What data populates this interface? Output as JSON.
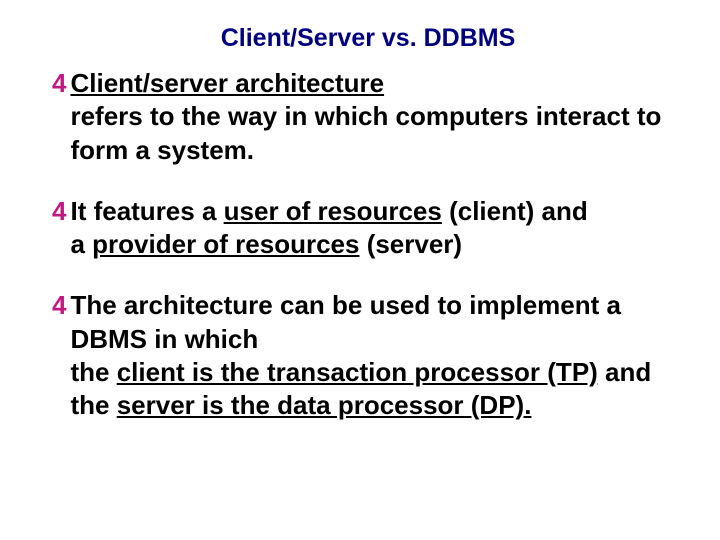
{
  "title": "Client/Server vs. DDBMS",
  "bullets": {
    "b0": {
      "lead": "Client/server architecture",
      "rest": "refers to the way in which computers interact to form a system."
    },
    "b1": {
      "pre": "It features a ",
      "u1": "user of resources",
      "mid1": " (client) and",
      "br": "a ",
      "u2": "provider of resources",
      "mid2": " (server)"
    },
    "b2": {
      "l1": "The architecture can be used to implement a DBMS in which",
      "l2a": "the ",
      "u1": "client is the transaction processor (TP)",
      "l2b": " and the ",
      "u2": "server is the data processor (DP).",
      "l2c": ""
    }
  },
  "glyph": "4"
}
